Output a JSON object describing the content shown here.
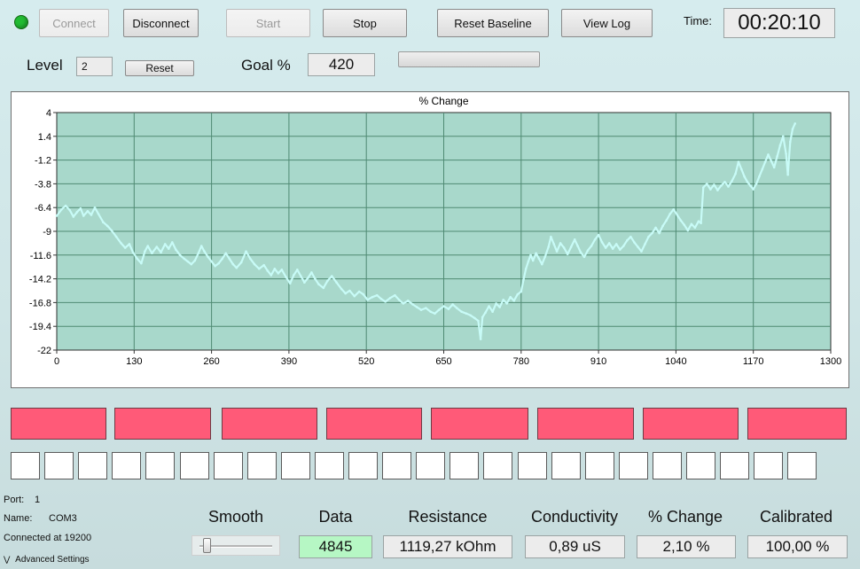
{
  "toolbar": {
    "connect": "Connect",
    "disconnect": "Disconnect",
    "start": "Start",
    "stop": "Stop",
    "reset_baseline": "Reset Baseline",
    "view_log": "View Log",
    "time_label": "Time:",
    "time_value": "00:20:10",
    "status_color": "#22bb33"
  },
  "level": {
    "label": "Level",
    "value": "2",
    "reset": "Reset"
  },
  "goal": {
    "label": "Goal %",
    "value": "420"
  },
  "chart_data": {
    "type": "line",
    "title": "% Change",
    "xlabel": "",
    "ylabel": "",
    "xlim": [
      0,
      1300
    ],
    "ylim": [
      -22,
      4
    ],
    "xticks": [
      "0",
      "130",
      "260",
      "390",
      "520",
      "650",
      "780",
      "910",
      "1040",
      "1170",
      "1300"
    ],
    "yticks": [
      "4",
      "1.4",
      "-1.2",
      "-3.8",
      "-6.4",
      "-9",
      "-11.6",
      "-14.2",
      "-16.8",
      "-19.4",
      "-22"
    ],
    "grid": true,
    "series": [
      {
        "color": "#c8fbf7",
        "points": [
          [
            0,
            -7.3
          ],
          [
            8,
            -6.6
          ],
          [
            15,
            -6.2
          ],
          [
            22,
            -6.7
          ],
          [
            28,
            -7.4
          ],
          [
            34,
            -6.9
          ],
          [
            40,
            -6.5
          ],
          [
            45,
            -7.3
          ],
          [
            52,
            -6.8
          ],
          [
            58,
            -7.2
          ],
          [
            64,
            -6.4
          ],
          [
            70,
            -7.1
          ],
          [
            78,
            -8.0
          ],
          [
            85,
            -8.4
          ],
          [
            92,
            -8.9
          ],
          [
            100,
            -9.6
          ],
          [
            108,
            -10.3
          ],
          [
            115,
            -10.8
          ],
          [
            122,
            -10.4
          ],
          [
            128,
            -11.3
          ],
          [
            135,
            -12.0
          ],
          [
            142,
            -12.5
          ],
          [
            148,
            -11.2
          ],
          [
            153,
            -10.6
          ],
          [
            160,
            -11.4
          ],
          [
            168,
            -10.7
          ],
          [
            175,
            -11.3
          ],
          [
            182,
            -10.4
          ],
          [
            188,
            -10.9
          ],
          [
            194,
            -10.2
          ],
          [
            200,
            -11.0
          ],
          [
            207,
            -11.6
          ],
          [
            214,
            -12.0
          ],
          [
            220,
            -12.3
          ],
          [
            226,
            -12.6
          ],
          [
            232,
            -12.2
          ],
          [
            238,
            -11.4
          ],
          [
            243,
            -10.6
          ],
          [
            248,
            -11.2
          ],
          [
            254,
            -11.8
          ],
          [
            260,
            -12.3
          ],
          [
            266,
            -12.8
          ],
          [
            272,
            -12.5
          ],
          [
            278,
            -12.0
          ],
          [
            284,
            -11.4
          ],
          [
            290,
            -12.0
          ],
          [
            296,
            -12.6
          ],
          [
            302,
            -13.0
          ],
          [
            310,
            -12.4
          ],
          [
            318,
            -11.2
          ],
          [
            325,
            -12.0
          ],
          [
            332,
            -12.6
          ],
          [
            340,
            -13.1
          ],
          [
            348,
            -12.7
          ],
          [
            354,
            -13.3
          ],
          [
            360,
            -13.8
          ],
          [
            366,
            -13.1
          ],
          [
            372,
            -13.6
          ],
          [
            378,
            -13.2
          ],
          [
            385,
            -14.0
          ],
          [
            392,
            -14.7
          ],
          [
            398,
            -13.8
          ],
          [
            404,
            -13.2
          ],
          [
            410,
            -13.9
          ],
          [
            416,
            -14.6
          ],
          [
            422,
            -14.1
          ],
          [
            428,
            -13.5
          ],
          [
            434,
            -14.2
          ],
          [
            440,
            -14.8
          ],
          [
            448,
            -15.2
          ],
          [
            455,
            -14.4
          ],
          [
            462,
            -13.9
          ],
          [
            470,
            -14.6
          ],
          [
            478,
            -15.3
          ],
          [
            485,
            -15.8
          ],
          [
            492,
            -15.5
          ],
          [
            500,
            -16.1
          ],
          [
            508,
            -15.6
          ],
          [
            515,
            -15.9
          ],
          [
            522,
            -16.5
          ],
          [
            530,
            -16.2
          ],
          [
            538,
            -16.0
          ],
          [
            545,
            -16.4
          ],
          [
            552,
            -16.7
          ],
          [
            560,
            -16.3
          ],
          [
            568,
            -16.0
          ],
          [
            575,
            -16.5
          ],
          [
            582,
            -16.9
          ],
          [
            590,
            -16.6
          ],
          [
            598,
            -17.0
          ],
          [
            605,
            -17.3
          ],
          [
            612,
            -17.6
          ],
          [
            620,
            -17.4
          ],
          [
            628,
            -17.8
          ],
          [
            635,
            -18.0
          ],
          [
            642,
            -17.6
          ],
          [
            650,
            -17.2
          ],
          [
            658,
            -17.5
          ],
          [
            665,
            -17.0
          ],
          [
            672,
            -17.4
          ],
          [
            680,
            -17.8
          ],
          [
            688,
            -18.0
          ],
          [
            695,
            -18.2
          ],
          [
            702,
            -18.5
          ],
          [
            708,
            -18.8
          ],
          [
            712,
            -20.8
          ],
          [
            715,
            -18.4
          ],
          [
            720,
            -17.9
          ],
          [
            726,
            -17.2
          ],
          [
            732,
            -17.8
          ],
          [
            738,
            -16.9
          ],
          [
            744,
            -17.3
          ],
          [
            750,
            -16.5
          ],
          [
            756,
            -16.9
          ],
          [
            762,
            -16.2
          ],
          [
            768,
            -16.6
          ],
          [
            774,
            -15.9
          ],
          [
            780,
            -15.6
          ],
          [
            784,
            -14.3
          ],
          [
            788,
            -13.1
          ],
          [
            792,
            -12.3
          ],
          [
            796,
            -11.6
          ],
          [
            800,
            -12.2
          ],
          [
            805,
            -11.4
          ],
          [
            810,
            -12.0
          ],
          [
            815,
            -12.6
          ],
          [
            820,
            -11.8
          ],
          [
            826,
            -10.7
          ],
          [
            830,
            -9.6
          ],
          [
            835,
            -10.4
          ],
          [
            840,
            -11.2
          ],
          [
            846,
            -10.3
          ],
          [
            852,
            -10.8
          ],
          [
            858,
            -11.5
          ],
          [
            864,
            -10.7
          ],
          [
            870,
            -9.9
          ],
          [
            875,
            -10.6
          ],
          [
            880,
            -11.3
          ],
          [
            886,
            -11.8
          ],
          [
            892,
            -11.1
          ],
          [
            898,
            -10.6
          ],
          [
            904,
            -9.9
          ],
          [
            910,
            -9.4
          ],
          [
            916,
            -10.2
          ],
          [
            922,
            -10.8
          ],
          [
            928,
            -10.3
          ],
          [
            934,
            -10.9
          ],
          [
            940,
            -10.4
          ],
          [
            946,
            -11.0
          ],
          [
            952,
            -10.6
          ],
          [
            958,
            -10.0
          ],
          [
            964,
            -9.6
          ],
          [
            970,
            -10.2
          ],
          [
            976,
            -10.7
          ],
          [
            982,
            -11.2
          ],
          [
            988,
            -10.4
          ],
          [
            994,
            -9.6
          ],
          [
            1000,
            -9.2
          ],
          [
            1006,
            -8.6
          ],
          [
            1012,
            -9.2
          ],
          [
            1018,
            -8.4
          ],
          [
            1024,
            -7.8
          ],
          [
            1030,
            -7.1
          ],
          [
            1036,
            -6.6
          ],
          [
            1042,
            -7.2
          ],
          [
            1048,
            -7.8
          ],
          [
            1054,
            -8.3
          ],
          [
            1060,
            -8.9
          ],
          [
            1066,
            -8.2
          ],
          [
            1072,
            -8.6
          ],
          [
            1078,
            -7.9
          ],
          [
            1082,
            -8.1
          ],
          [
            1086,
            -4.2
          ],
          [
            1092,
            -3.8
          ],
          [
            1098,
            -4.4
          ],
          [
            1104,
            -3.9
          ],
          [
            1110,
            -4.5
          ],
          [
            1116,
            -4.0
          ],
          [
            1122,
            -3.6
          ],
          [
            1128,
            -4.1
          ],
          [
            1134,
            -3.5
          ],
          [
            1140,
            -2.7
          ],
          [
            1145,
            -1.4
          ],
          [
            1150,
            -2.2
          ],
          [
            1155,
            -3.0
          ],
          [
            1160,
            -3.6
          ],
          [
            1165,
            -4.0
          ],
          [
            1170,
            -4.4
          ],
          [
            1175,
            -3.8
          ],
          [
            1180,
            -3.0
          ],
          [
            1185,
            -2.2
          ],
          [
            1190,
            -1.4
          ],
          [
            1195,
            -0.6
          ],
          [
            1200,
            -1.3
          ],
          [
            1205,
            -2.0
          ],
          [
            1210,
            -0.8
          ],
          [
            1215,
            0.4
          ],
          [
            1220,
            1.4
          ],
          [
            1225,
            -0.5
          ],
          [
            1228,
            -2.8
          ],
          [
            1232,
            0.8
          ],
          [
            1236,
            2.2
          ],
          [
            1240,
            2.8
          ]
        ]
      }
    ]
  },
  "indicators": {
    "bar_color": "#ff5a78",
    "bars": 8,
    "cells": 24
  },
  "port": {
    "port_label": "Port:",
    "port_value": "1",
    "name_label": "Name:",
    "name_value": "COM3",
    "connected": "Connected at 19200",
    "advanced": "Advanced Settings"
  },
  "readouts": {
    "smooth_label": "Smooth",
    "smooth_level": 0.05,
    "data_label": "Data",
    "data_value": "4845",
    "data_color": "#b6f7c4",
    "resistance_label": "Resistance",
    "resistance_value": "1119,27 kOhm",
    "conductivity_label": "Conductivity",
    "conductivity_value": "0,89 uS",
    "change_label": "% Change",
    "change_value": "2,10 %",
    "calibrated_label": "Calibrated",
    "calibrated_value": "100,00 %"
  }
}
